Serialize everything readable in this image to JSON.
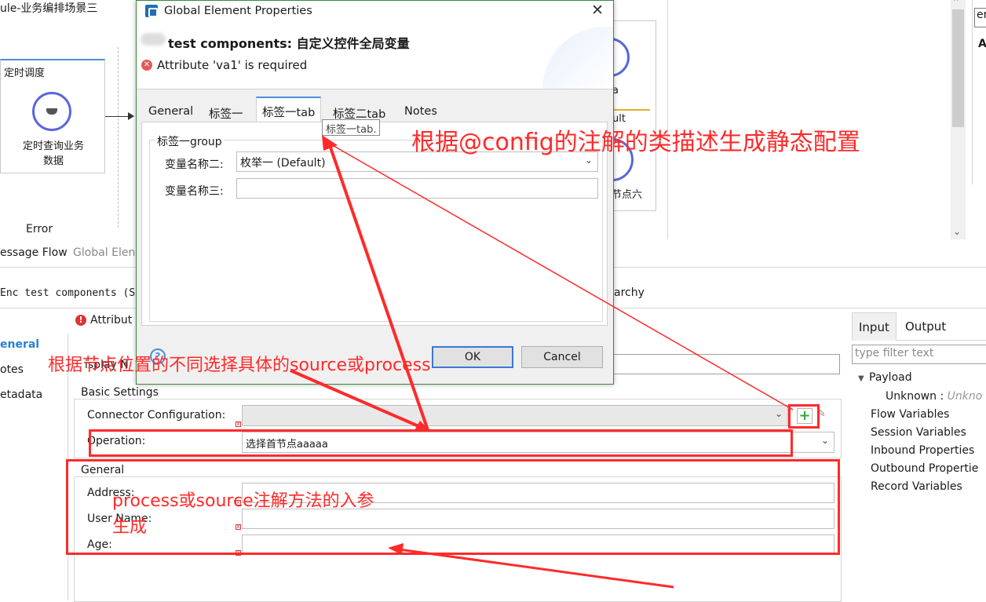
{
  "canvas": {
    "title": "ule-业务编排场景三",
    "schedule_box": {
      "header": "定时调度",
      "caption_line1": "定时查询业务",
      "caption_line2": "数据"
    },
    "error_label": "Error",
    "tabs": [
      "essage Flow",
      "Global Elen"
    ],
    "right_fragments": [
      "a",
      "ult",
      "节点六"
    ],
    "side_input_value": "er",
    "side_letter": "A"
  },
  "properties": {
    "enc_line": "Enc test components (S",
    "hierarchy_fragment": "archy",
    "left_nav": [
      "eneral",
      "otes",
      "etadata"
    ],
    "attribute_error": "Attribut",
    "display_name_label": "isplay N",
    "basic_settings_title": "Basic Settings",
    "connector_label": "Connector Configuration:",
    "operation_label": "Operation:",
    "operation_value": "选择首节点aaaaa",
    "general_title": "General",
    "fields": [
      {
        "label": "Address:"
      },
      {
        "label": "User Name:"
      },
      {
        "label": "Age:"
      }
    ]
  },
  "io_panel": {
    "tabs": [
      "Input",
      "Output"
    ],
    "filter_placeholder": "type filter text",
    "tree": {
      "payload": "Payload",
      "unknown_label": "Unknown :",
      "unknown_value": "Unkno",
      "items": [
        "Flow Variables",
        "Session Variables",
        "Inbound Properties",
        "Outbound Propertie",
        "Record Variables"
      ]
    }
  },
  "dialog": {
    "title": "Global Element Properties",
    "subtitle": "test components: 自定义控件全局变量",
    "error": "Attribute 'va1' is required",
    "tabs": [
      "General",
      "标签一",
      "标签一tab",
      "标签二tab",
      "Notes"
    ],
    "active_tab_index": 2,
    "tooltip": "标签一tab.",
    "group_title": "标签一group",
    "var2_label": "变量名称二:",
    "var2_value": "枚举一 (Default)",
    "var3_label": "变量名称三:",
    "ok_label": "OK",
    "cancel_label": "Cancel"
  },
  "annotations": {
    "config_note": "根据@config的注解的类描述生成静态配置",
    "source_process_note": "根据节点位置的不同选择具体的source或process",
    "params_note_line1": "process或source注解方法的入参",
    "params_note_line2": "生成",
    "color": "#ff2a2a"
  }
}
